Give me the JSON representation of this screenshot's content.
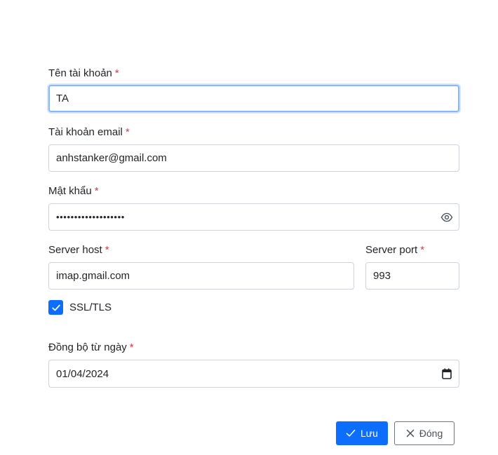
{
  "form": {
    "account_name": {
      "label": "Tên tài khoản",
      "required": "*",
      "value": "TA"
    },
    "email": {
      "label": "Tài khoản email",
      "required": "*",
      "value": "anhstanker@gmail.com"
    },
    "password": {
      "label": "Mật khẩu",
      "required": "*",
      "value": "•••••••••••••••••••"
    },
    "server_host": {
      "label": "Server host",
      "required": "*",
      "value": "imap.gmail.com"
    },
    "server_port": {
      "label": "Server port",
      "required": "*",
      "value": "993"
    },
    "ssl": {
      "label": "SSL/TLS",
      "checked": true
    },
    "sync_date": {
      "label": "Đồng bộ từ ngày",
      "required": "*",
      "value": "01/04/2024"
    }
  },
  "actions": {
    "save_label": "Lưu",
    "close_label": "Đóng"
  },
  "icons": {
    "password_toggle": "eye-icon",
    "date_picker": "calendar-icon",
    "save": "check-icon",
    "close": "close-icon"
  },
  "colors": {
    "primary": "#0d6efd",
    "required": "#dc3545",
    "focus_border": "#86b7fe",
    "border": "#ced4da"
  }
}
